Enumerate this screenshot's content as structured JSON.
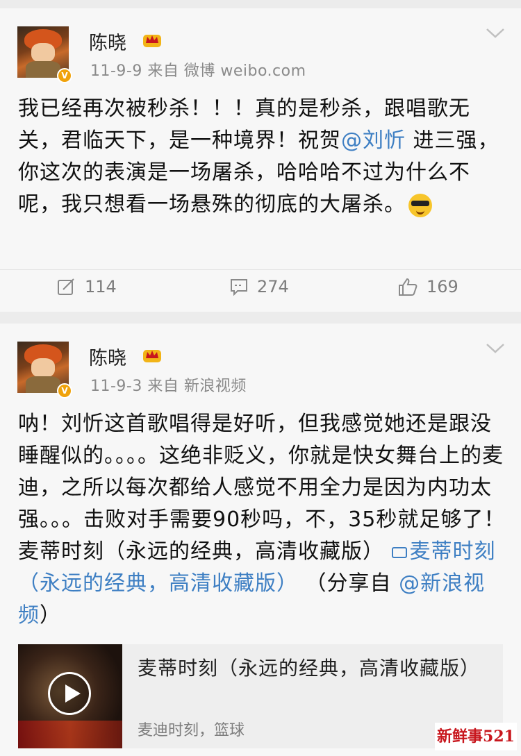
{
  "posts": [
    {
      "user": {
        "name": "陈晓",
        "verified": "V"
      },
      "meta": "11-9-9  来自 微博 weibo.com",
      "text": {
        "part1": "我已经再次被秒杀！！！真的是秒杀，跟唱歌无关，君临天下，是一种境界！祝贺",
        "mention": "@刘忻",
        "part2": " 进三强，你这次的表演是一场屠杀，哈哈哈不过为什么不呢，我只想看一场悬殊的彻底的大屠杀。"
      },
      "actions": {
        "repost": "114",
        "comment": "274",
        "like": "169"
      }
    },
    {
      "user": {
        "name": "陈晓",
        "verified": "V"
      },
      "meta": "11-9-3  来自 新浪视频",
      "text": {
        "part1": "呐！刘忻这首歌唱得是好听，但我感觉她还是跟没睡醒似的。。。。这绝非贬义，你就是快女舞台上的麦迪，之所以每次都给人感觉不用全力是因为内功太强。。。击败对手需要90秒吗，不，35秒就足够了！麦蒂时刻（永远的经典，高清收藏版）",
        "video_link": "麦蒂时刻（永远的经典，高清收藏版）",
        "share": "  （分享自 ",
        "share_link": "@新浪视频",
        "share_end": "）"
      },
      "video": {
        "title": "麦蒂时刻（永远的经典，高清收藏版）",
        "tags": "麦迪时刻，篮球"
      }
    }
  ],
  "watermark": "新鲜事521",
  "colors": {
    "link": "#3e7fc3",
    "badge": "#f0a20b"
  }
}
